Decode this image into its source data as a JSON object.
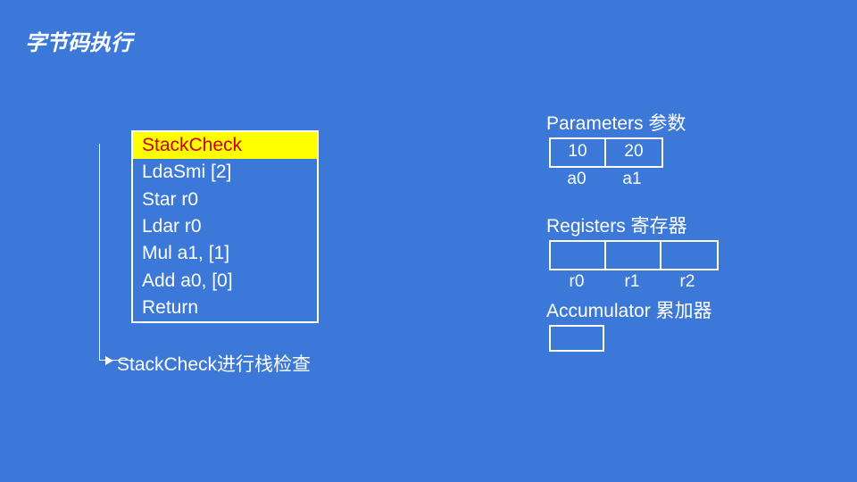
{
  "title": "字节码执行",
  "bytecode": {
    "highlight_index": 0,
    "lines": [
      "StackCheck",
      "LdaSmi [2]",
      "Star r0",
      "Ldar r0",
      "Mul a1, [1]",
      "Add a0, [0]",
      "Return"
    ]
  },
  "annotation": "StackCheck进行栈检查",
  "parameters": {
    "label": "Parameters 参数",
    "cells": [
      "10",
      "20"
    ],
    "names": [
      "a0",
      "a1"
    ]
  },
  "registers": {
    "label": "Registers 寄存器",
    "cells": [
      "",
      "",
      ""
    ],
    "names": [
      "r0",
      "r1",
      "r2"
    ]
  },
  "accumulator": {
    "label": "Accumulator 累加器",
    "value": ""
  }
}
